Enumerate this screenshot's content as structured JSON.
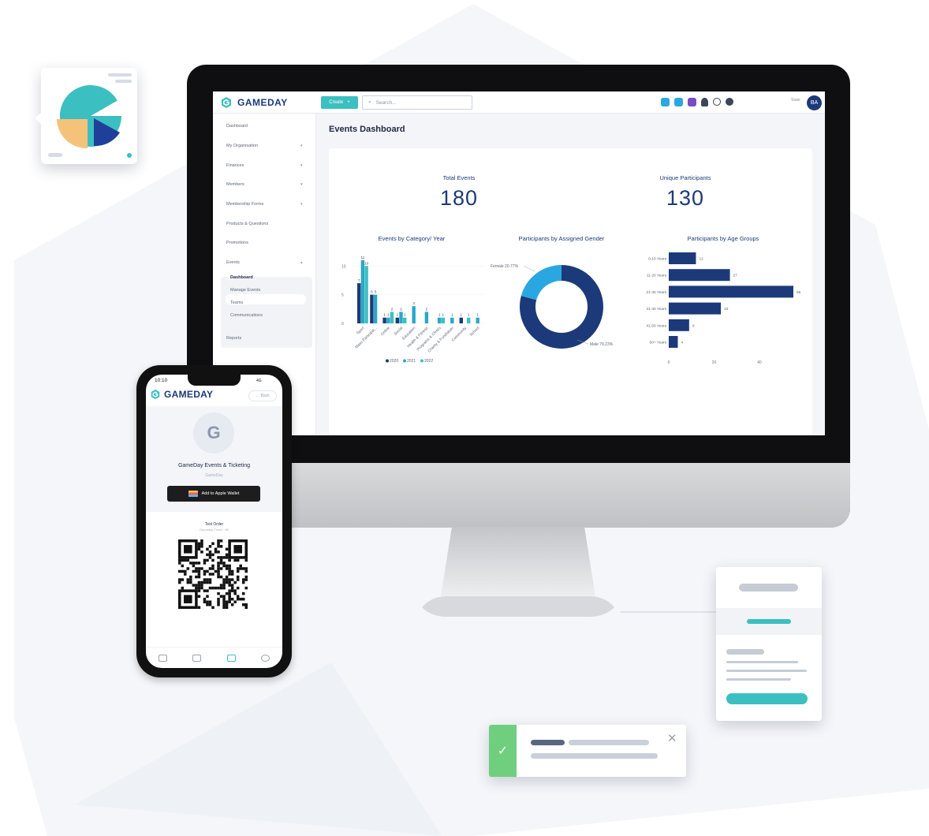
{
  "app": {
    "brand": "GAMEDAY",
    "create_label": "Create",
    "search_placeholder": "Search...",
    "state_label": "State",
    "avatar_initials": "BA"
  },
  "sidebar": {
    "items": [
      "Dashboard",
      "My Organisation",
      "Finances",
      "Members",
      "Membership Forms",
      "Products & Questions",
      "Promotions",
      "Events",
      "Reports"
    ],
    "events_sub": [
      "Dashboard",
      "Manage Events",
      "Teams",
      "Communications"
    ]
  },
  "page": {
    "title": "Events Dashboard"
  },
  "kpis": [
    {
      "label": "Total Events",
      "value": "180"
    },
    {
      "label": "Unique Participants",
      "value": "130"
    }
  ],
  "chart_data": [
    {
      "type": "bar",
      "title": "Events by Category/ Year",
      "categories": [
        "Sport",
        "Mass Participat...",
        "Online",
        "Social",
        "Education",
        "Health & Fitness",
        "Programs & Clinics",
        "Charity & Fundraiser",
        "Community",
        "School"
      ],
      "series": [
        {
          "name": "2020",
          "values": [
            7,
            5,
            1,
            1,
            0,
            0,
            0,
            0,
            1,
            0
          ]
        },
        {
          "name": "2021",
          "values": [
            11,
            5,
            1,
            2,
            3,
            2,
            1,
            1,
            0,
            1
          ]
        },
        {
          "name": "2022",
          "values": [
            10,
            0,
            2,
            1,
            0,
            0,
            1,
            0,
            1,
            0
          ]
        }
      ],
      "y_ticks": [
        "0",
        "5",
        "10"
      ],
      "ylim": [
        0,
        11
      ],
      "legend": [
        "2020",
        "2021",
        "2022"
      ]
    },
    {
      "type": "pie",
      "title": "Participants by Assigned Gender",
      "slices": [
        {
          "label": "Female",
          "value": 20.77,
          "text": "Female 20.77%"
        },
        {
          "label": "Male",
          "value": 79.23,
          "text": "Male 79.23%"
        }
      ]
    },
    {
      "type": "bar",
      "orientation": "horizontal",
      "title": "Participants by Age Groups",
      "categories": [
        "0-10 Years",
        "11-20 Years",
        "21-30 Years",
        "31-40 Years",
        "41-50 Years",
        "50+ Years"
      ],
      "values": [
        12,
        27,
        55,
        23,
        9,
        4
      ],
      "x_ticks": [
        "0",
        "20",
        "40"
      ],
      "xlim": [
        0,
        55
      ]
    }
  ],
  "colors": {
    "c2020": "#1c3a7a",
    "c2021": "#2aa7c9",
    "c2022": "#3cbfc0",
    "female": "#2aa7e0",
    "male": "#1c3a7a"
  },
  "phone": {
    "time": "10:10",
    "signal": "4G",
    "brand": "GAMEDAY",
    "back_label": "← Back",
    "avatar_letter": "G",
    "event_name": "GameDay Events & Ticketing",
    "event_org": "GameDay",
    "wallet_label": "Add to Apple Wallet",
    "order_title": "Test Order",
    "order_sub": "Gameday Ticket - $0"
  }
}
